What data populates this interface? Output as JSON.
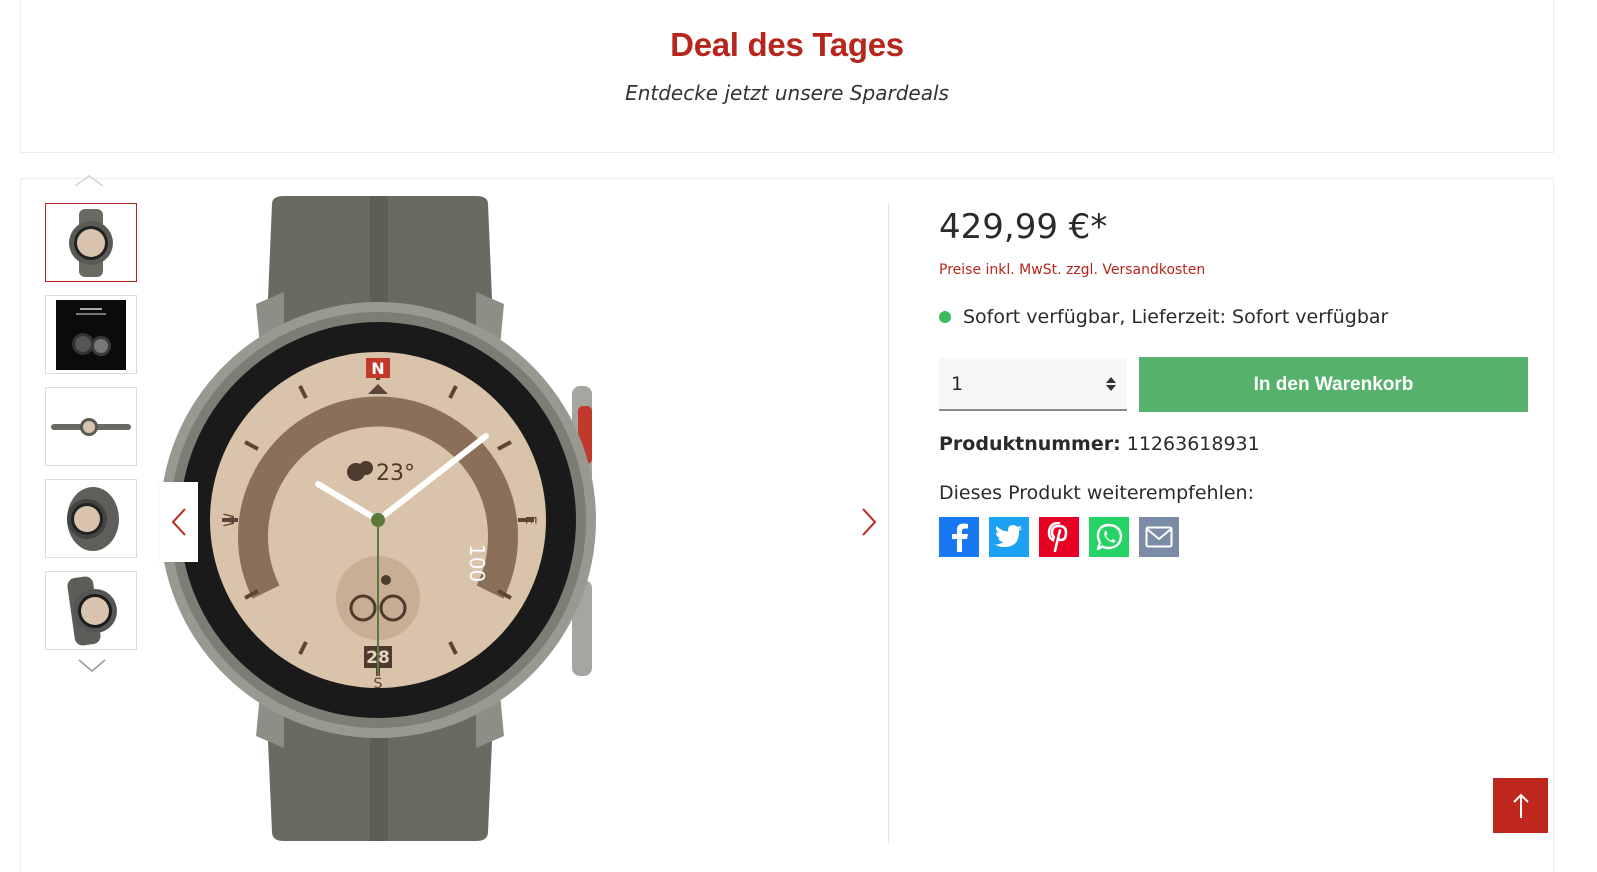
{
  "header": {
    "title": "Deal des Tages",
    "subtitle": "Entdecke jetzt unsere Spardeals"
  },
  "gallery": {
    "thumbnail_count": 5,
    "active_index": 0,
    "thumb_up_icon": "chevron-up-icon",
    "thumb_down_icon": "chevron-down-icon",
    "prev_icon": "chevron-left-icon",
    "next_icon": "chevron-right-icon"
  },
  "product": {
    "price": "429,99 €*",
    "price_note": "Preise inkl. MwSt. zzgl. Versandkosten",
    "availability": "Sofort verfügbar, Lieferzeit: Sofort verfügbar",
    "quantity": "1",
    "cart_label": "In den Warenkorb",
    "number_label": "Produktnummer:",
    "number_value": "11263618931",
    "recommend_label": "Dieses Produkt weiterempfehlen:"
  },
  "share": [
    {
      "name": "facebook",
      "color": "#1877f2"
    },
    {
      "name": "twitter",
      "color": "#1da1f2"
    },
    {
      "name": "pinterest",
      "color": "#e60023"
    },
    {
      "name": "whatsapp",
      "color": "#25d366"
    },
    {
      "name": "email",
      "color": "#7b8da6"
    }
  ],
  "colors": {
    "accent": "#b7261c",
    "cart_button": "#55b16c",
    "availability_dot": "#3cb95b"
  },
  "watch_face": {
    "weather": "23°",
    "battery": "100",
    "date": "28",
    "north": "N",
    "south": "S",
    "east": "E",
    "west": "W"
  }
}
